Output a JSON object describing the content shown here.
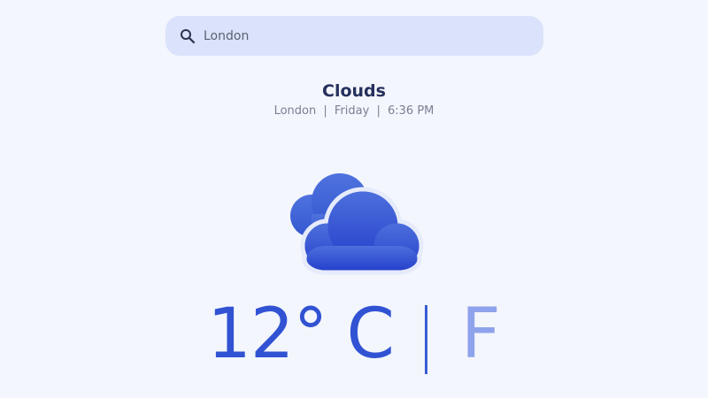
{
  "search": {
    "value": "London",
    "icon": "search-icon"
  },
  "weather": {
    "condition": "Clouds",
    "city": "London",
    "day": "Friday",
    "time": "6:36 PM",
    "separator": "|",
    "icon": "clouds-icon",
    "temperature": "12°",
    "unit_celsius": "C",
    "unit_separator": "|",
    "unit_fahrenheit": "F",
    "active_unit": "C"
  },
  "colors": {
    "background": "#f3f6fd",
    "search_bg": "#dbe2fb",
    "accent": "#3153d3",
    "inactive_unit": "#8fa3ec",
    "title": "#26305c",
    "subtext": "#7b8094"
  }
}
